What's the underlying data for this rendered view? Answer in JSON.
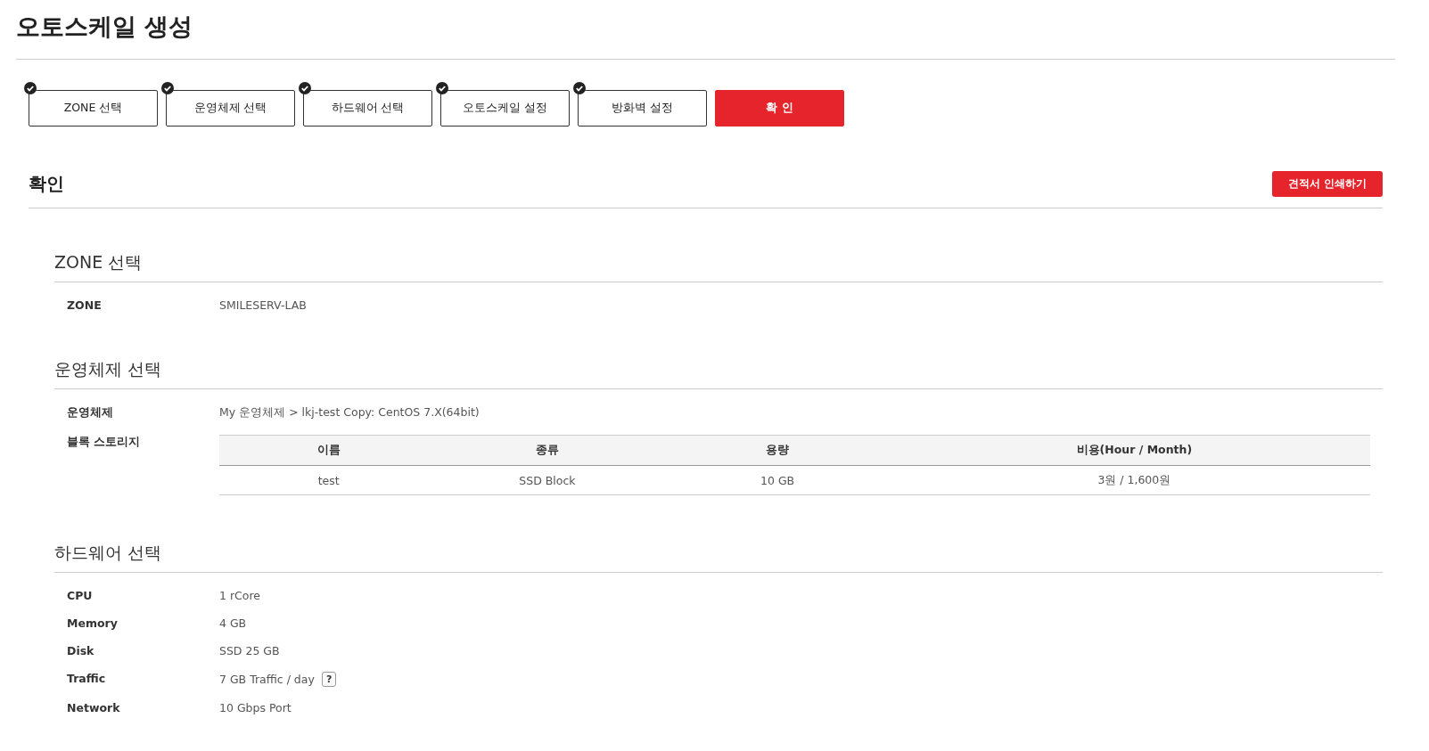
{
  "page_title": "오토스케일 생성",
  "steps": [
    {
      "label": "ZONE 선택",
      "done": true,
      "selected": false
    },
    {
      "label": "운영체제 선택",
      "done": true,
      "selected": false
    },
    {
      "label": "하드웨어 선택",
      "done": true,
      "selected": false
    },
    {
      "label": "오토스케일 설정",
      "done": true,
      "selected": false
    },
    {
      "label": "방화벽 설정",
      "done": true,
      "selected": false
    },
    {
      "label": "확 인",
      "done": false,
      "selected": true
    }
  ],
  "confirm": {
    "title": "확인",
    "print_button": "견적서 인쇄하기"
  },
  "sections": [
    {
      "title": "ZONE 선택",
      "rows": [
        {
          "kind": "text",
          "label": "ZONE",
          "value": "SMILESERV-LAB"
        }
      ]
    },
    {
      "title": "운영체제 선택",
      "rows": [
        {
          "kind": "text",
          "label": "운영체제",
          "value": "My 운영체제 > lkj-test Copy: CentOS 7.X(64bit)"
        },
        {
          "kind": "table",
          "label": "블록 스토리지",
          "columns": [
            "이름",
            "종류",
            "용량",
            "비용(Hour / Month)"
          ],
          "rows": [
            [
              "test",
              "SSD Block",
              "10 GB",
              "3원 / 1,600원"
            ]
          ]
        }
      ]
    },
    {
      "title": "하드웨어 선택",
      "rows": [
        {
          "kind": "text",
          "label": "CPU",
          "value": "1 rCore"
        },
        {
          "kind": "text",
          "label": "Memory",
          "value": "4 GB"
        },
        {
          "kind": "text",
          "label": "Disk",
          "value": "SSD 25 GB"
        },
        {
          "kind": "text",
          "label": "Traffic",
          "value": "7 GB Traffic / day",
          "help": "?"
        },
        {
          "kind": "text",
          "label": "Network",
          "value": "10 Gbps Port"
        }
      ]
    }
  ]
}
